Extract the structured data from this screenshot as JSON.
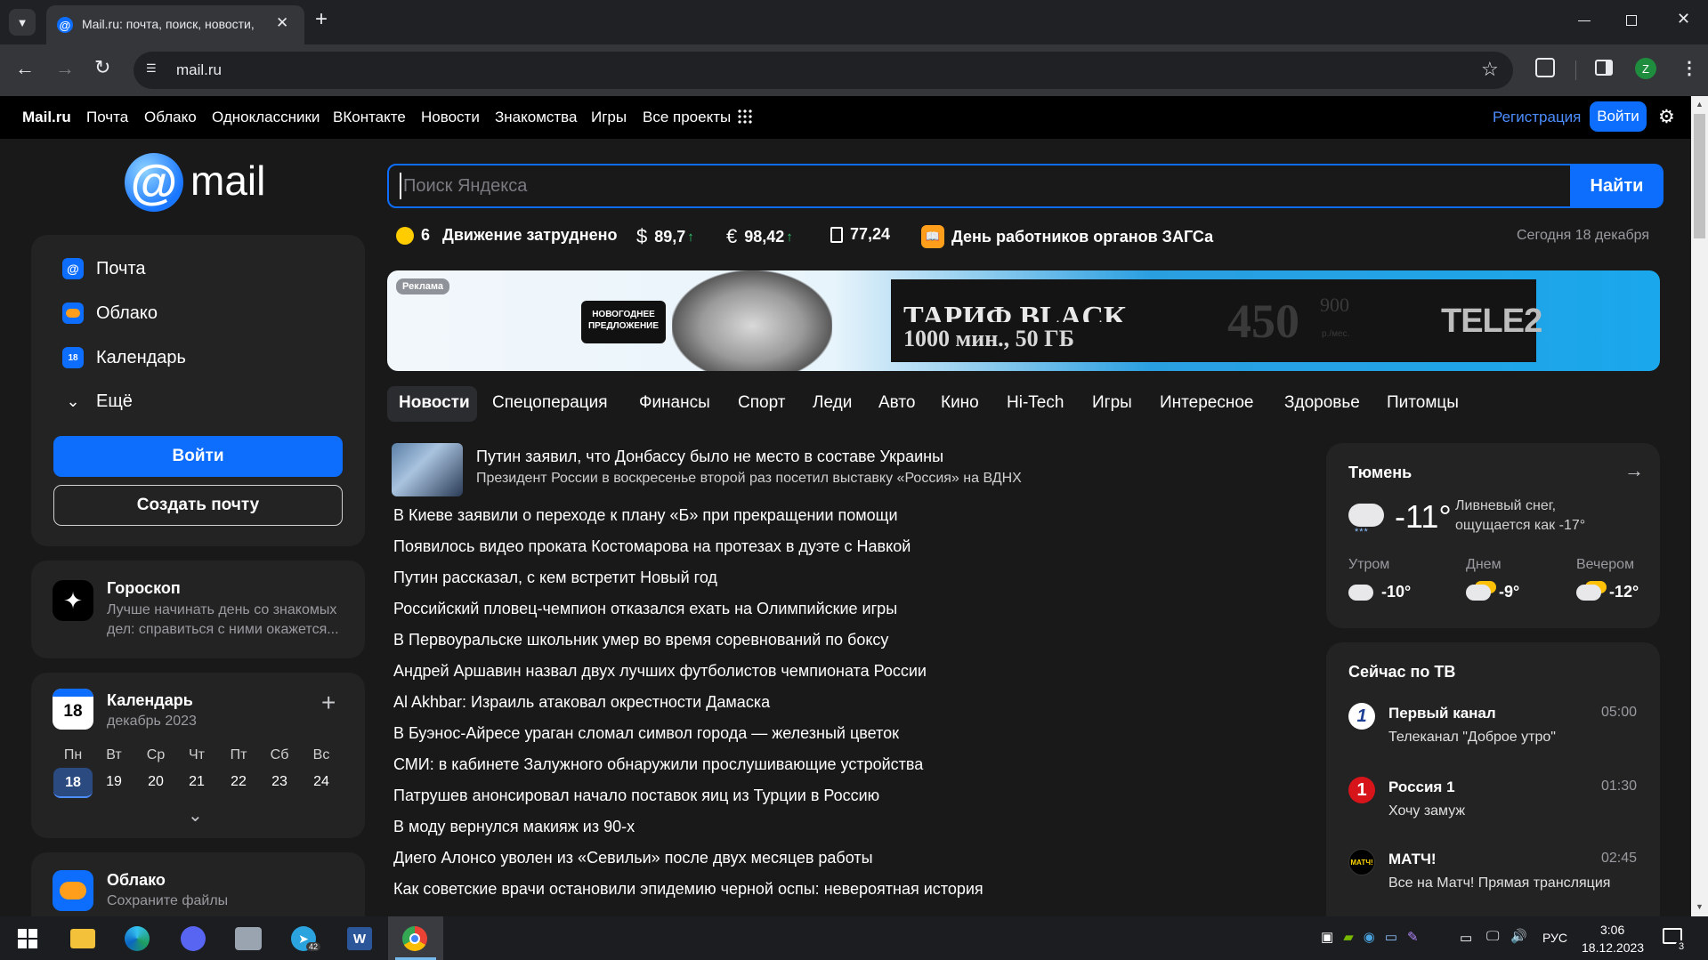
{
  "browser": {
    "tab_title": "Mail.ru: почта, поиск, новости,",
    "url": "mail.ru",
    "profile_initial": "Z"
  },
  "topnav": {
    "brand": "Mail.ru",
    "links": [
      "Почта",
      "Облако",
      "Одноклассники",
      "ВКонтакте",
      "Новости",
      "Знакомства",
      "Игры",
      "Все проекты"
    ],
    "register": "Регистрация",
    "login": "Войти"
  },
  "logo_text": "mail",
  "search": {
    "placeholder": "Поиск Яндекса",
    "button": "Найти"
  },
  "infobar": {
    "traffic_score": "6",
    "traffic_text": "Движение затруднено",
    "usd": "89,7",
    "eur": "98,42",
    "oil": "77,24",
    "holiday": "День работников органов ЗАГСа",
    "date": "Сегодня 18 декабря"
  },
  "ad": {
    "badge": "Реклама",
    "offer": "НОВОГОДНЕЕ ПРЕДЛОЖЕНИЕ",
    "title": "ТАРИФ BLACK",
    "subtitle": "1000 мин., 50 ГБ",
    "price": "450",
    "old_price": "900",
    "price_unit": "р./мес.",
    "brand": "TELE2"
  },
  "categories": [
    "Новости",
    "Спецоперация",
    "Финансы",
    "Спорт",
    "Леди",
    "Авто",
    "Кино",
    "Hi-Tech",
    "Игры",
    "Интересное",
    "Здоровье",
    "Питомцы"
  ],
  "news": {
    "lead_title": "Путин заявил, что Донбассу было не место в составе Украины",
    "lead_subtitle": "Президент России в воскресенье второй раз посетил выставку «Россия» на ВДНХ",
    "items": [
      "В Киеве заявили о переходе к плану «Б» при прекращении помощи",
      "Появилось видео проката Костомарова на протезах в дуэте с Навкой",
      "Путин рассказал, с кем встретит Новый год",
      "Российский пловец-чемпион отказался ехать на Олимпийские игры",
      "В Первоуральске школьник умер во время соревнований по боксу",
      "Андрей Аршавин назвал двух лучших футболистов чемпионата России",
      "Al Akhbar: Израиль атаковал окрестности Дамаска",
      "В Буэнос-Айресе ураган сломал символ города — железный цветок",
      "СМИ: в кабинете Залужного обнаружили прослушивающие устройства",
      "Патрушев анонсировал начало поставок яиц из Турции в Россию",
      "В моду вернулся макияж из 90-х",
      "Диего Алонсо уволен из «Севильи» после двух месяцев работы",
      "Как советские врачи остановили эпидемию черной оспы: невероятная история"
    ]
  },
  "sidebar": {
    "items": [
      "Почта",
      "Облако",
      "Календарь",
      "Ещё"
    ],
    "calendar_icon_day": "18",
    "login": "Войти",
    "create": "Создать почту"
  },
  "horoscope": {
    "title": "Гороскоп",
    "text1": "Лучше начинать день со знакомых",
    "text2": "дел: справиться с ними окажется..."
  },
  "calendar": {
    "title": "Календарь",
    "day": "18",
    "month": "декабрь 2023",
    "weekdays": [
      "Пн",
      "Вт",
      "Ср",
      "Чт",
      "Пт",
      "Сб",
      "Вс"
    ],
    "dates": [
      "18",
      "19",
      "20",
      "21",
      "22",
      "23",
      "24"
    ]
  },
  "cloud": {
    "title": "Облако",
    "subtitle": "Сохраните файлы"
  },
  "weather": {
    "city": "Тюмень",
    "temp": "-11°",
    "desc1": "Ливневый снег,",
    "desc2": "ощущается как -17°",
    "parts": [
      {
        "label": "Утром",
        "temp": "-10°"
      },
      {
        "label": "Днем",
        "temp": "-9°"
      },
      {
        "label": "Вечером",
        "temp": "-12°"
      }
    ]
  },
  "tv": {
    "title": "Сейчас по ТВ",
    "channels": [
      {
        "name": "Первый канал",
        "time": "05:00",
        "show": "Телеканал \"Доброе утро\"",
        "logo": "1"
      },
      {
        "name": "Россия 1",
        "time": "01:30",
        "show": "Хочу замуж",
        "logo": "1"
      },
      {
        "name": "МАТЧ!",
        "time": "02:45",
        "show": "Все на Матч! Прямая трансляция",
        "logo": "МАТЧ!"
      }
    ]
  },
  "taskbar": {
    "lang": "РУС",
    "time": "3:06",
    "date": "18.12.2023",
    "telegram_badge": "42",
    "notif_count": "3"
  },
  "colors": {
    "accent": "#0d6efd",
    "link": "#4c8dff",
    "page_bg": "#19191a",
    "card_bg": "#232324"
  }
}
